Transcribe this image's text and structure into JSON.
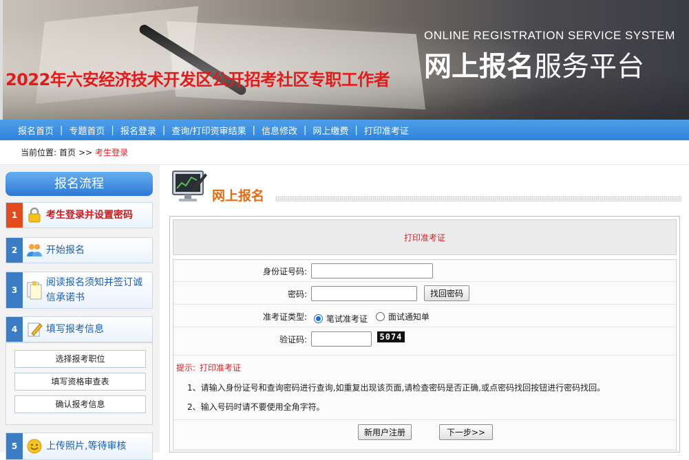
{
  "banner": {
    "title": "2022年六安经济技术开发区公开招考社区专职工作者",
    "subtitle_en": "ONLINE REGISTRATION SERVICE SYSTEM",
    "subtitle_cn_bold": "网上报名",
    "subtitle_cn_light": "服务平台"
  },
  "nav": {
    "items": [
      "报名首页",
      "专题首页",
      "报名登录",
      "查询/打印资审结果",
      "信息修改",
      "网上缴费",
      "打印准考证"
    ],
    "separator": "|"
  },
  "breadcrumb": {
    "prefix": "当前位置:",
    "home": "首页",
    "arrow": ">>",
    "current": "考生登录"
  },
  "sidebar": {
    "heading": "报名流程",
    "steps": [
      {
        "num": "1",
        "label": "考生登录并设置密码",
        "icon": "lock-icon"
      },
      {
        "num": "2",
        "label": "开始报名",
        "icon": "users-icon"
      },
      {
        "num": "3",
        "label": "阅读报名须知并签订诚信承诺书",
        "icon": "document-icon"
      },
      {
        "num": "4",
        "label": "填写报考信息",
        "icon": "edit-icon"
      },
      {
        "num": "5",
        "label": "上传照片,等待审核",
        "icon": "smiley-icon"
      }
    ],
    "sub_buttons": [
      "选择报考职位",
      "填写资格审查表",
      "确认报考信息"
    ]
  },
  "main": {
    "title": "网上报名",
    "card_heading": "打印准考证",
    "form": {
      "id_label": "身份证号码:",
      "id_value": "",
      "password_label": "密码:",
      "password_value": "",
      "recover_button": "找回密码",
      "ticket_type_label": "准考证类型:",
      "ticket_options": [
        "笔试准考证",
        "面试通知单"
      ],
      "ticket_selected": "笔试准考证",
      "captcha_label": "验证码:",
      "captcha_value": "",
      "captcha_image_text": "5074"
    },
    "tips": {
      "heading": "提示:",
      "heading_detail": "打印准考证",
      "lines": [
        "1、请输入身份证号和查询密码进行查询,如重复出现该页面,请检查密码是否正确,或点密码找回按钮进行密码找回。",
        "2、输入号码时请不要使用全角字符。"
      ]
    },
    "buttons": {
      "register": "新用户注册",
      "next": "下一步>>"
    }
  },
  "colors": {
    "nav_blue": "#2f83db",
    "title_red": "#e41a1a",
    "accent_orange": "#e86a10",
    "step_active": "#e34b1e"
  }
}
